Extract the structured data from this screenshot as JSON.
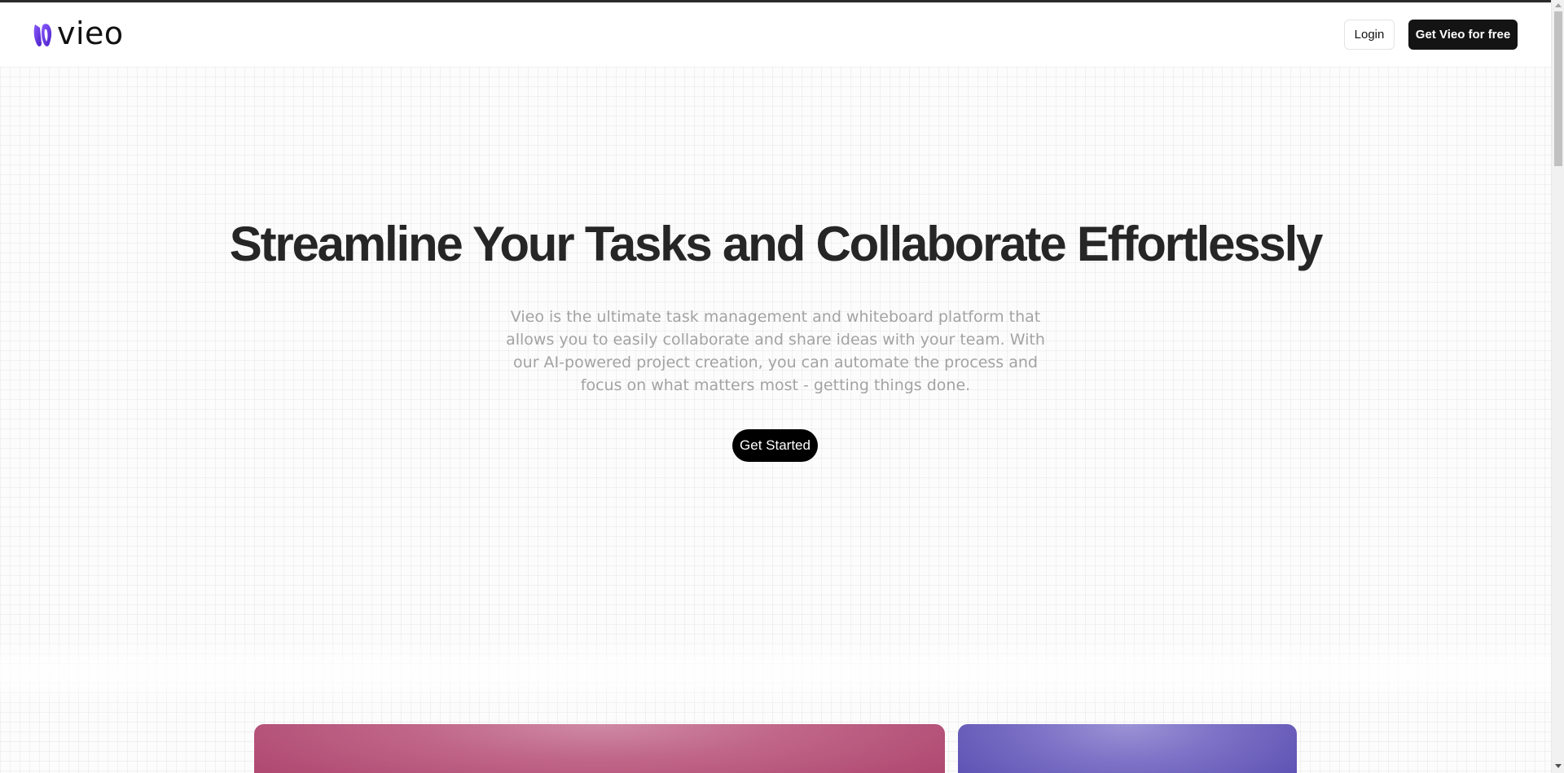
{
  "header": {
    "logo_text": "vieo",
    "login_label": "Login",
    "cta_label": "Get Vieo for free"
  },
  "hero": {
    "title": "Streamline Your Tasks and Collaborate Effortlessly",
    "subtitle": "Vieo is the ultimate task management and whiteboard platform that allows you to easily collaborate and share ideas with your team. With our AI-powered project creation, you can automate the process and focus on what matters most - getting things done.",
    "button_label": "Get Started"
  },
  "colors": {
    "brand": "#6d3de0",
    "cta_bg": "#141414",
    "card_pink": "#c06689",
    "card_purple": "#7d72c6"
  },
  "icons": {
    "logo": "vieo-logo-mark-icon"
  }
}
